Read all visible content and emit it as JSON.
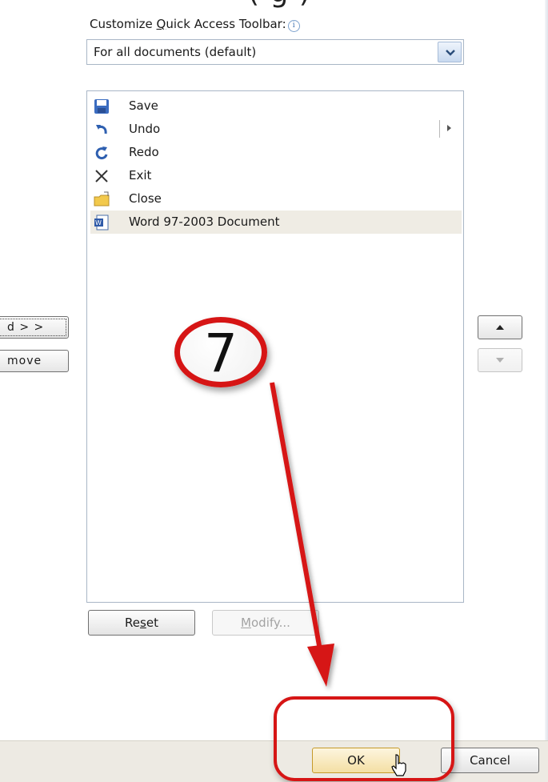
{
  "header": {
    "clipped_heading": "(    g         )",
    "label_prefix": "Customize ",
    "label_accel": "Q",
    "label_suffix": "uick Access Toolbar:",
    "info_icon": "info-icon"
  },
  "scope_select": {
    "value": "For all documents (default)",
    "icon": "chevron-down-icon"
  },
  "toolbar_list": {
    "items": [
      {
        "label": "Save",
        "icon": "save-icon"
      },
      {
        "label": "Undo",
        "icon": "undo-icon",
        "has_submenu": true
      },
      {
        "label": "Redo",
        "icon": "redo-icon"
      },
      {
        "label": "Exit",
        "icon": "close-x-icon"
      },
      {
        "label": "Close",
        "icon": "folder-close-icon"
      },
      {
        "label": "Word 97-2003 Document",
        "icon": "word-doc-icon",
        "selected": true
      }
    ]
  },
  "side_buttons": {
    "add": "d > >",
    "remove": "move"
  },
  "bottom_buttons": {
    "reset_pre": "Re",
    "reset_accel": "s",
    "reset_post": "et",
    "modify_accel": "M",
    "modify_post": "odify..."
  },
  "dialog_buttons": {
    "ok": "OK",
    "cancel": "Cancel"
  },
  "annotation": {
    "step_number": "7",
    "color": "#d61515"
  },
  "colors": {
    "selection": "#efece4",
    "footer": "#edeae3",
    "border": "#a9b6c6"
  }
}
